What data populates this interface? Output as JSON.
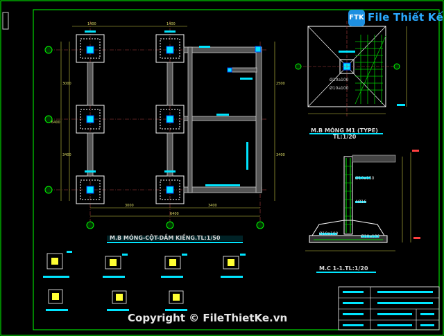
{
  "watermark": {
    "logo_text": "File Thiết Kế.vn",
    "logo_icon_text": "FTK",
    "copyright": "Copyright © FileThietKe.vn"
  },
  "drawing": {
    "plan_title": "M.B MÓNG-CỘT-DẦM KIỀNG.TL:1/50",
    "footing_plan_title": "M.B MÓNG M1 (TYPE)",
    "footing_plan_scale": "TL:1/20",
    "section_title": "M.C 1-1.TL:1/20",
    "rebar_labels": [
      "Ø10a100",
      "Ø10a100",
      "Ø10a150",
      "4Ø16",
      "Ø10a100",
      "Ø10a100"
    ]
  },
  "colors": {
    "background": "#000000",
    "line": "#ffffff",
    "column": "#00e5ff",
    "rebar": "#00c800",
    "dim": "#ffff66",
    "axis": "#ff3030",
    "border": "#00ff00"
  }
}
